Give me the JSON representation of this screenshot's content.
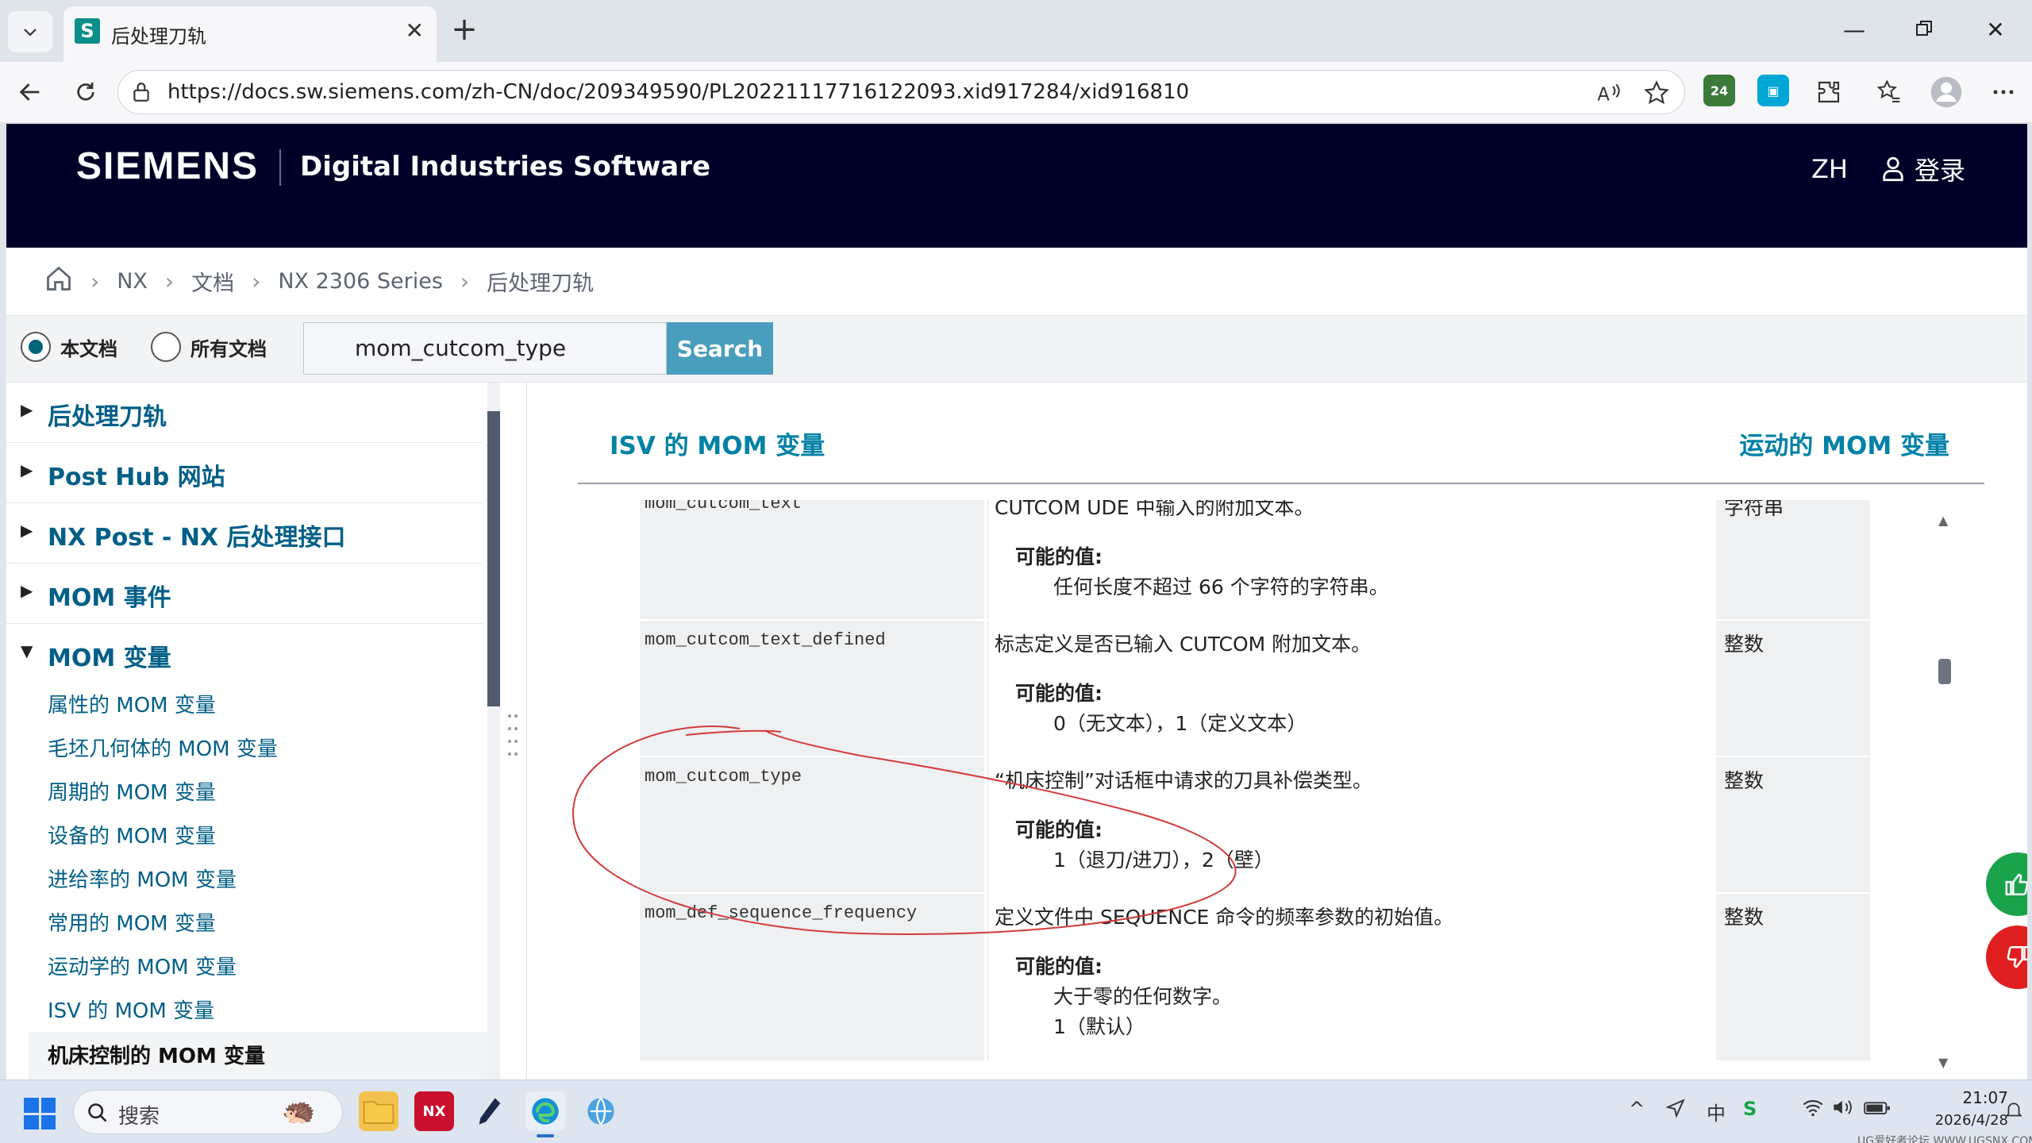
{
  "browser": {
    "tab_title": "后处理刀轨",
    "favicon_letter": "S",
    "url": "https://docs.sw.siemens.com/zh-CN/doc/209349590/PL20221117716122093.xid917284/xid916810",
    "ext_badge": "24"
  },
  "site": {
    "logo": "SIEMENS",
    "subtitle": "Digital Industries Software",
    "lang": "ZH",
    "login": "登录"
  },
  "breadcrumb": [
    "NX",
    "文档",
    "NX 2306 Series",
    "后处理刀轨"
  ],
  "search": {
    "scope_this": "本文档",
    "scope_all": "所有文档",
    "query": "mom_cutcom_type",
    "button": "Search"
  },
  "sidebar": {
    "top_items": [
      {
        "label": "后处理刀轨",
        "arrow": "▶"
      },
      {
        "label": "Post Hub 网站",
        "arrow": "▶"
      },
      {
        "label": "NX Post - NX 后处理接口",
        "arrow": "▶"
      },
      {
        "label": "MOM 事件",
        "arrow": "▶"
      },
      {
        "label": "MOM 变量",
        "arrow": "▼"
      }
    ],
    "sub_items": [
      "属性的 MOM 变量",
      "毛坯几何体的 MOM 变量",
      "周期的 MOM 变量",
      "设备的 MOM 变量",
      "进给率的 MOM 变量",
      "常用的 MOM 变量",
      "运动学的 MOM 变量",
      "ISV 的 MOM 变量",
      "机床控制的 MOM 变量"
    ]
  },
  "content": {
    "prev": "ISV 的 MOM 变量",
    "next": "运动的 MOM 变量",
    "rows": [
      {
        "name": "mom_cutcom_text",
        "desc": "CUTCOM UDE 中输入的附加文本。",
        "pv_label": "可能的值:",
        "values": [
          "任何长度不超过 66 个字符的字符串。"
        ],
        "type": "字符串"
      },
      {
        "name": "mom_cutcom_text_defined",
        "desc": "标志定义是否已输入 CUTCOM 附加文本。",
        "pv_label": "可能的值:",
        "values": [
          "0（无文本），1（定义文本）"
        ],
        "type": "整数"
      },
      {
        "name": "mom_cutcom_type",
        "desc": "“机床控制”对话框中请求的刀具补偿类型。",
        "pv_label": "可能的值:",
        "values": [
          "1（退刀/进刀），2（壁）"
        ],
        "type": "整数"
      },
      {
        "name": "mom_def_sequence_frequency",
        "desc": "定义文件中 SEQUENCE 命令的频率参数的初始值。",
        "pv_label": "可能的值:",
        "values": [
          "大于零的任何数字。",
          "1（默认）"
        ],
        "type": "整数"
      }
    ]
  },
  "taskbar": {
    "search_placeholder": "搜索",
    "nx_label": "NX",
    "ime": "中",
    "time": "21:07",
    "date": "2026/4/28",
    "watermark": "UG爱好者论坛 WWW.UGSNX.COM"
  },
  "colors": {
    "header_bg": "#000028",
    "link": "#005f87",
    "accent": "#4a9ebd",
    "like": "#1aa34a",
    "dislike": "#e02020",
    "annotation": "#d33a3a"
  }
}
